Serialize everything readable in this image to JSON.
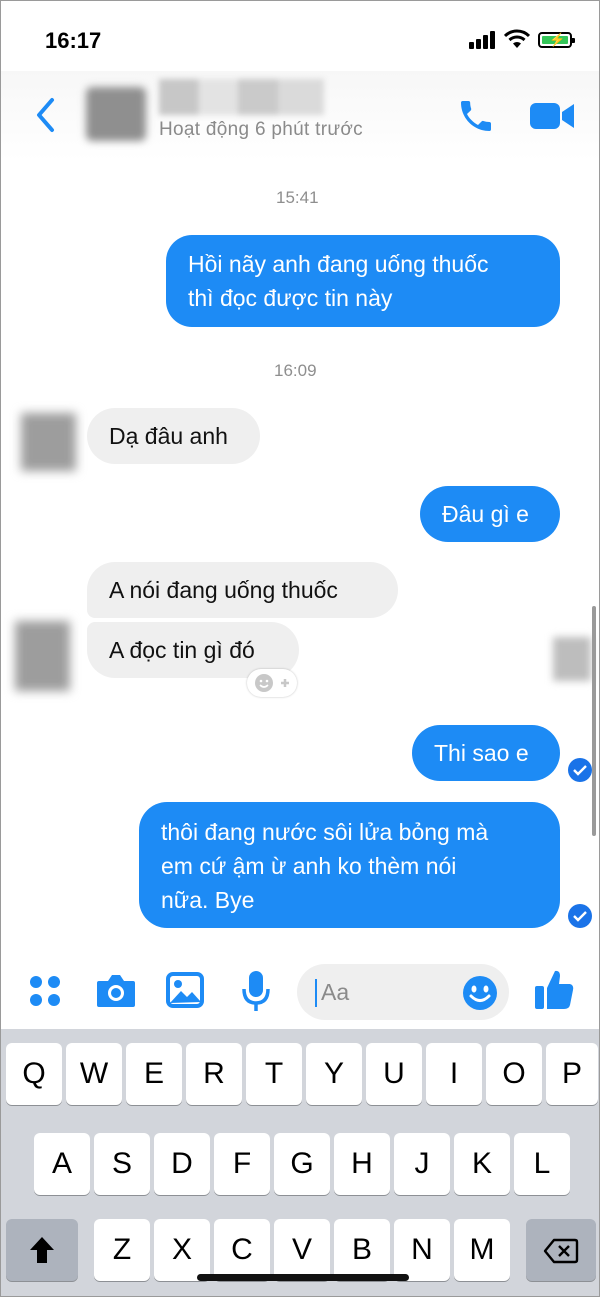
{
  "status": {
    "time": "16:17"
  },
  "header": {
    "active_status": "Hoạt động 6 phút trước"
  },
  "messages": [
    {
      "type": "timestamp",
      "text": "15:41"
    },
    {
      "type": "outgoing",
      "lines": [
        "Hồi nãy anh đang uống thuốc",
        "thì đọc được tin này"
      ]
    },
    {
      "type": "timestamp",
      "text": "16:09"
    },
    {
      "type": "incoming",
      "text": "Dạ đâu anh"
    },
    {
      "type": "outgoing",
      "text": "Đâu gì e"
    },
    {
      "type": "incoming",
      "text": "A nói đang uống thuốc"
    },
    {
      "type": "incoming",
      "text": "A đọc tin gì đó"
    },
    {
      "type": "outgoing",
      "text": "Thi sao e"
    },
    {
      "type": "outgoing",
      "lines": [
        "thôi đang nước sôi lửa bỏng mà",
        "em cứ ậm ừ anh ko thèm nói",
        "nữa. Bye"
      ]
    }
  ],
  "composer": {
    "placeholder": "Aa"
  },
  "keyboard": {
    "row1": [
      "Q",
      "W",
      "E",
      "R",
      "T",
      "Y",
      "U",
      "I",
      "O",
      "P"
    ],
    "row2": [
      "A",
      "S",
      "D",
      "F",
      "G",
      "H",
      "J",
      "K",
      "L"
    ],
    "row3": [
      "Z",
      "X",
      "C",
      "V",
      "B",
      "N",
      "M"
    ]
  },
  "colors": {
    "accent": "#1d8bf5",
    "incoming_bubble": "#efefef",
    "keyboard_bg": "#d2d5db"
  },
  "icons": [
    "back-chevron-icon",
    "phone-icon",
    "video-camera-icon",
    "menu-dots-icon",
    "camera-icon",
    "image-icon",
    "microphone-icon",
    "emoji-icon",
    "like-icon",
    "shift-icon",
    "backspace-icon",
    "add-reaction-icon",
    "seen-check-icon"
  ]
}
